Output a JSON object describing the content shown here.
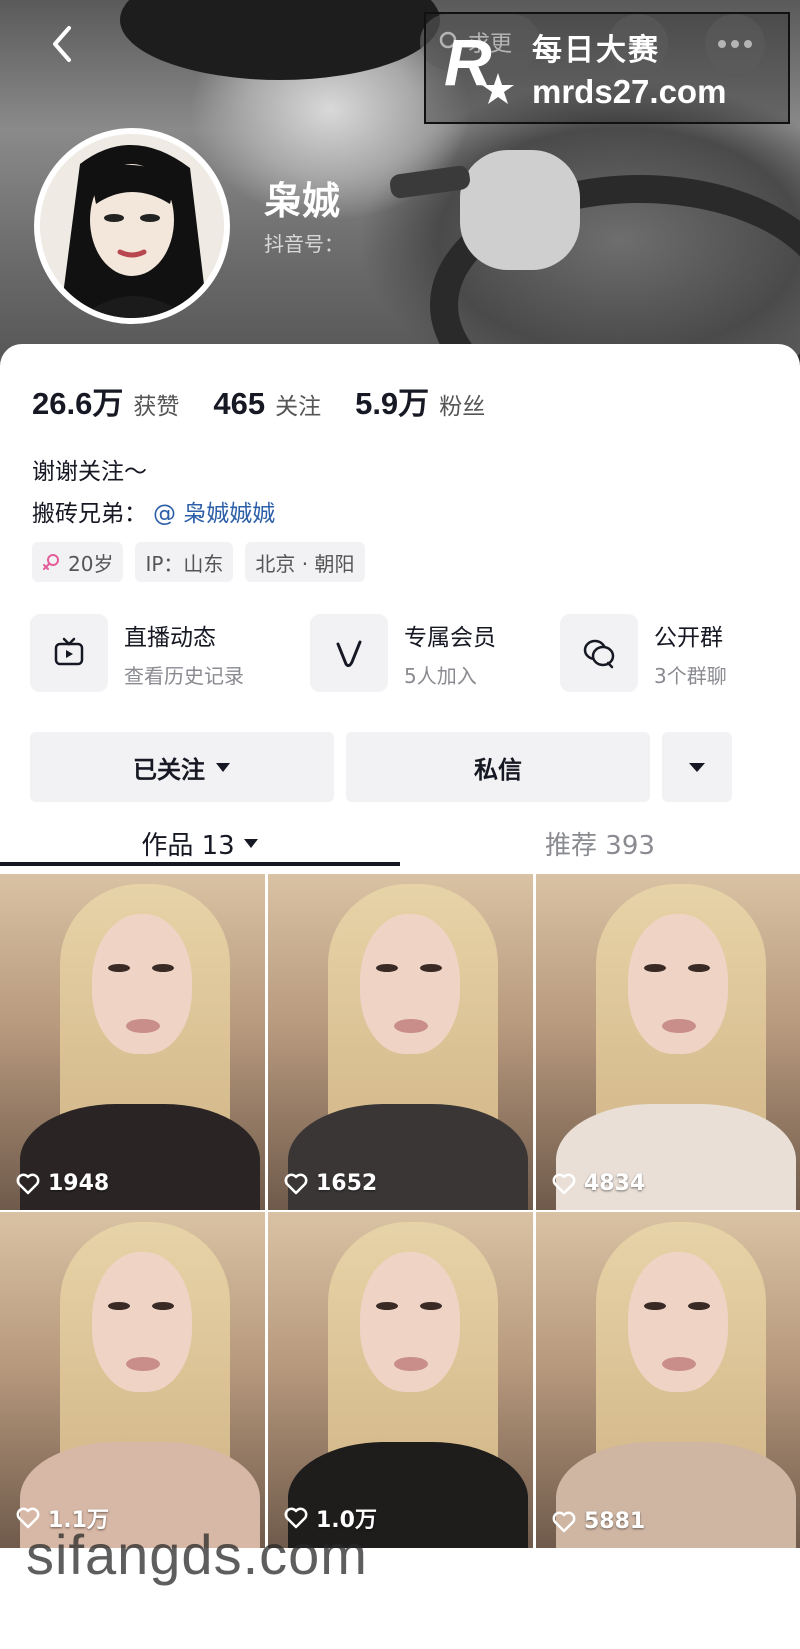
{
  "header": {
    "top_pill_text": "求更",
    "watermark_cn": "每日大赛",
    "watermark_url": "mrds27.com",
    "watermark_badge": "每日大赛",
    "display_name": "枭娍",
    "douyin_id_label": "抖音号："
  },
  "stats": [
    {
      "num": "26.6万",
      "label": "获赞"
    },
    {
      "num": "465",
      "label": "关注"
    },
    {
      "num": "5.9万",
      "label": "粉丝"
    }
  ],
  "bio": {
    "line1": "谢谢关注～",
    "line2_prefix": "搬砖兄弟：",
    "line2_mention": "@ 枭娍娍娍"
  },
  "tags": {
    "age": "20岁",
    "ip": "IP：山东",
    "location": "北京 · 朝阳"
  },
  "features": [
    {
      "title": "直播动态",
      "sub": "查看历史记录",
      "icon": "tv-icon"
    },
    {
      "title": "专属会员",
      "sub": "5人加入",
      "icon": "v-icon"
    },
    {
      "title": "公开群",
      "sub": "3个群聊",
      "icon": "chat-icon"
    }
  ],
  "actions": {
    "follow": "已关注",
    "message": "私信"
  },
  "tabs": {
    "works": "作品 13",
    "recommend": "推荐 393"
  },
  "videos": [
    {
      "likes": "1948"
    },
    {
      "likes": "1652"
    },
    {
      "likes": "4834"
    },
    {
      "likes": "1.1万"
    },
    {
      "likes": "1.0万"
    },
    {
      "likes": "5881"
    }
  ],
  "site_watermark": "sifangds.com",
  "colors": {
    "accent_link": "#2c5fa8",
    "text_primary": "#161823",
    "text_secondary": "#8a8b91",
    "button_bg": "#f2f2f4",
    "age_icon": "#e55c9a"
  }
}
